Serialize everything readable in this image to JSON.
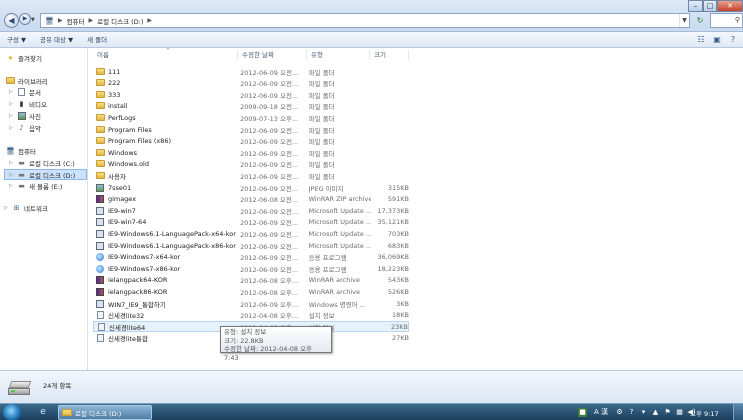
{
  "address": {
    "crumbs": [
      "컴퓨터",
      "로컬 디스크 (D:)"
    ],
    "separator": "▶"
  },
  "toolbar": {
    "organize": "구성 ▼",
    "share": "공유 대상 ▼",
    "new_folder": "새 폴더"
  },
  "nav": {
    "favorites": "즐겨찾기",
    "libraries": "라이브러리",
    "documents": "문서",
    "videos": "비디오",
    "pictures": "사진",
    "music": "음악",
    "computer": "컴퓨터",
    "drive_c": "로컬 디스크 (C:)",
    "drive_d": "로컬 디스크 (D:)",
    "drive_e": "새 볼륨 (E:)",
    "network": "네트워크"
  },
  "columns": {
    "name": "이름",
    "date": "수정한 날짜",
    "type": "유형",
    "size": "크기"
  },
  "files": [
    {
      "name": "111",
      "date": "2012-06-09 오전...",
      "type": "파일 폴더",
      "size": "",
      "icon": "folder-icon"
    },
    {
      "name": "222",
      "date": "2012-06-09 오전...",
      "type": "파일 폴더",
      "size": "",
      "icon": "folder-icon"
    },
    {
      "name": "333",
      "date": "2012-06-09 오전...",
      "type": "파일 폴더",
      "size": "",
      "icon": "folder-icon"
    },
    {
      "name": "install",
      "date": "2009-09-18 오전...",
      "type": "파일 폴더",
      "size": "",
      "icon": "folder-icon"
    },
    {
      "name": "PerfLogs",
      "date": "2009-07-13 오후...",
      "type": "파일 폴더",
      "size": "",
      "icon": "folder-icon"
    },
    {
      "name": "Program Files",
      "date": "2012-06-09 오전...",
      "type": "파일 폴더",
      "size": "",
      "icon": "folder-icon"
    },
    {
      "name": "Program Files (x86)",
      "date": "2012-06-09 오전...",
      "type": "파일 폴더",
      "size": "",
      "icon": "folder-icon"
    },
    {
      "name": "Windows",
      "date": "2012-06-09 오전...",
      "type": "파일 폴더",
      "size": "",
      "icon": "folder-icon"
    },
    {
      "name": "Windows.old",
      "date": "2012-06-09 오전...",
      "type": "파일 폴더",
      "size": "",
      "icon": "folder-icon"
    },
    {
      "name": "사용자",
      "date": "2012-06-09 오전...",
      "type": "파일 폴더",
      "size": "",
      "icon": "folder-icon"
    },
    {
      "name": "7sse01",
      "date": "2012-06-09 오전...",
      "type": "JPEG 이미지",
      "size": "315KB",
      "icon": "image-file-icon"
    },
    {
      "name": "gimagex",
      "date": "2012-06-08 오전...",
      "type": "WinRAR ZIP archive",
      "size": "591KB",
      "icon": "winrar-archive-icon"
    },
    {
      "name": "IE9-win7",
      "date": "2012-06-09 오전...",
      "type": "Microsoft Update ...",
      "size": "17,373KB",
      "icon": "update-package-icon"
    },
    {
      "name": "IE9-win7-64",
      "date": "2012-06-09 오전...",
      "type": "Microsoft Update ...",
      "size": "35,121KB",
      "icon": "update-package-icon"
    },
    {
      "name": "IE9-Windows6.1-LanguagePack-x64-kor",
      "date": "2012-06-09 오전...",
      "type": "Microsoft Update ...",
      "size": "703KB",
      "icon": "update-package-icon"
    },
    {
      "name": "IE9-Windows6.1-LanguagePack-x86-kor",
      "date": "2012-06-09 오전...",
      "type": "Microsoft Update ...",
      "size": "683KB",
      "icon": "update-package-icon"
    },
    {
      "name": "IE9-Windows7-x64-kor",
      "date": "2012-06-09 오전...",
      "type": "응용 프로그램",
      "size": "36,069KB",
      "icon": "ie-setup-icon"
    },
    {
      "name": "IE9-Windows7-x86-kor",
      "date": "2012-06-09 오전...",
      "type": "응용 프로그램",
      "size": "18,223KB",
      "icon": "ie-setup-icon"
    },
    {
      "name": "ielangpack64-KOR",
      "date": "2012-06-08 오후...",
      "type": "WinRAR archive",
      "size": "543KB",
      "icon": "winrar-archive-icon"
    },
    {
      "name": "ielangpack86-KOR",
      "date": "2012-06-08 오후...",
      "type": "WinRAR archive",
      "size": "526KB",
      "icon": "winrar-archive-icon"
    },
    {
      "name": "WIN7_IE9_통합하기",
      "date": "2012-06-09 오후...",
      "type": "Windows 명령어 ...",
      "size": "3KB",
      "icon": "batch-file-icon"
    },
    {
      "name": "신세경lite32",
      "date": "2012-04-08 오후...",
      "type": "설치 정보",
      "size": "18KB",
      "icon": "setup-info-icon"
    },
    {
      "name": "신세경lite64",
      "date": "2012-04-08 오후...",
      "type": "설치 정보",
      "size": "23KB",
      "icon": "setup-info-icon"
    },
    {
      "name": "신세경lite통합",
      "date": "2012-04-08 오후...",
      "type": "",
      "size": "27KB",
      "icon": "setup-info-icon"
    }
  ],
  "tooltip": {
    "type_line": "유형: 설치 정보",
    "size_line": "크기: 22.8KB",
    "date_line": "수정한 날짜: 2012-04-08 오후 7:43"
  },
  "details": {
    "item_count": "24개 항목"
  },
  "taskbar": {
    "active_window": "로컬 디스크 (D:)",
    "clock": "오후 9:17",
    "ime_label": "A 漢"
  },
  "colors": {
    "selection": "#cce2fa",
    "hover": "#e5f1fb",
    "header_text": "#4c607a",
    "secondary_text": "#6d6d6d"
  }
}
